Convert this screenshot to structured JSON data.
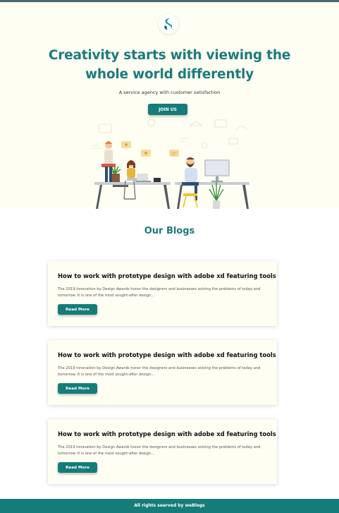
{
  "header": {
    "logo_icon": "brand-logo-icon"
  },
  "hero": {
    "title": "Creativity starts with viewing the whole world differently",
    "subtitle": "A service agency with customer satisfaction",
    "cta_label": "JOIN US",
    "illustration": "team-working-at-desks-illustration"
  },
  "blogs": {
    "heading": "Our Blogs",
    "posts": [
      {
        "title": "How to work with prototype design with adobe xd featuring tools",
        "excerpt": "The 2019 Innovation by Design Awards honor the designers and businesses solving the problems of today and tomorrow. It is one of the most sought-after design...",
        "button_label": "Read More"
      },
      {
        "title": "How to work with prototype design with adobe xd featuring tools",
        "excerpt": "The 2019 Innovation by Design Awards honor the designers and businesses solving the problems of today and tomorrow. It is one of the most sought-after design...",
        "button_label": "Read More"
      },
      {
        "title": "How to work with prototype design with adobe xd featuring tools",
        "excerpt": "The 2019 Innovation by Design Awards honor the designers and businesses solving the problems of today and tomorrow. It is one of the most sought-after design...",
        "button_label": "Read More"
      }
    ]
  },
  "footer": {
    "text": "All rights seerved by weBlogs"
  },
  "colors": {
    "brand_teal": "#157c78",
    "heading_teal": "#1c7b7b",
    "hero_background": "#fefef3",
    "card_background": "#fefef3",
    "top_border": "#4a6670"
  }
}
